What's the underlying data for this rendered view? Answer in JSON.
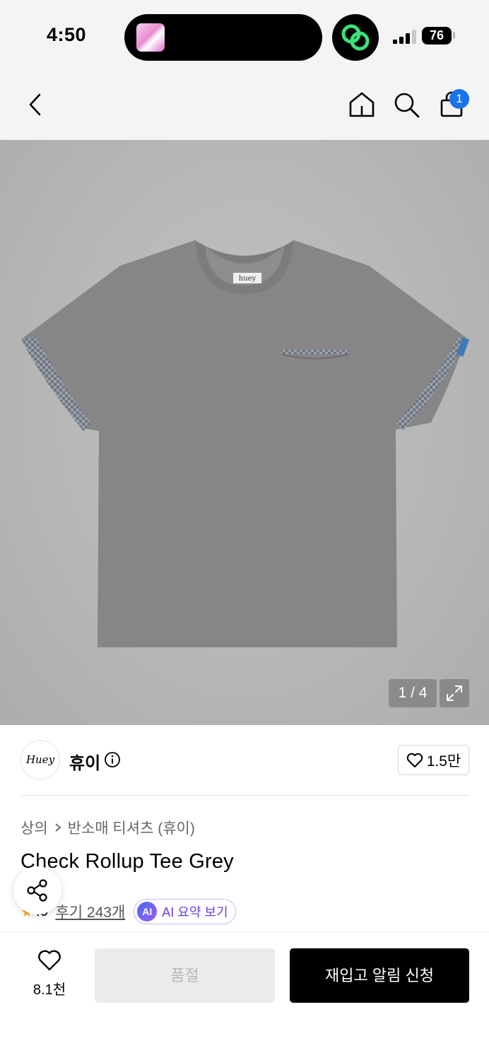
{
  "status_bar": {
    "time": "4:50",
    "battery": "76"
  },
  "nav": {
    "cart_count": "1"
  },
  "gallery": {
    "counter": "1 / 4",
    "tee_label": "huey"
  },
  "brand": {
    "logo_text": "Huey",
    "name": "휴이",
    "likes": "1.5만"
  },
  "breadcrumb": {
    "category": "상의",
    "subcategory": "반소매 티셔츠 (휴이)"
  },
  "product": {
    "title": "Check Rollup Tee Grey",
    "rating": ".9",
    "review_link": "후기 243개",
    "ai_badge": "AI",
    "ai_summary": "AI 요약 보기"
  },
  "bottom_bar": {
    "wish_count": "8.1천",
    "soldout_label": "품절",
    "restock_label": "재입고 알림 신청"
  },
  "colors": {
    "accent_blue": "#1a73e8",
    "ai_purple": "#6a3de8",
    "star": "#f5a623",
    "primary_button": "#000000",
    "disabled_button": "#ebebeb"
  }
}
